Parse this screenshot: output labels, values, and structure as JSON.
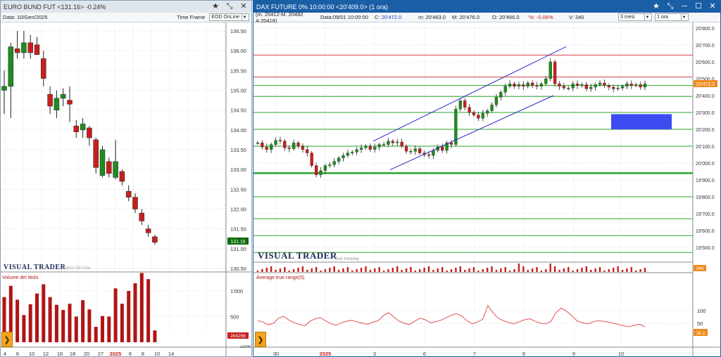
{
  "left": {
    "title": "EURO BUND FUT  <131.16>  -0.24%",
    "date_label": "Data: 10/Gen/2025",
    "timeframe_label": "Time Frame",
    "timeframe_value": "EOD OnLine",
    "brand": "VISUAL TRADER",
    "brand_sub": "Storico On Line",
    "volume_label": "Volume del titolo",
    "volume_value_badge": "284256",
    "volume_unit": "x1000",
    "last_price_badge": "131.16",
    "price_ticks": [
      "136.50",
      "136.00",
      "135.50",
      "135.00",
      "134.50",
      "134.00",
      "133.50",
      "133.00",
      "132.50",
      "132.00",
      "131.50",
      "131.00",
      "130.50"
    ],
    "volume_ticks": [
      "1'000",
      "500"
    ],
    "x_ticks": [
      "4",
      "6",
      "10",
      "12",
      "16",
      "18",
      "20",
      "27",
      "2025",
      "6",
      "8",
      "10",
      "14"
    ],
    "colors": {
      "up": "#1e8c1e",
      "down": "#c81e1e",
      "volume": "#b01515",
      "badge": "#0a6a0a"
    }
  },
  "right": {
    "title": "DAX FUTURE 0%  10:00:00  <20'409.0>  (1 ora)",
    "ohlc": {
      "mid": "(m. 20412-M. 20482 A:20418)",
      "date": "Data:09/01 10:00:00",
      "c_label": "C:",
      "c_value": "20'472.0",
      "m_label": "m:",
      "m_value": "20'463.0",
      "M_label": "M:",
      "M_value": "20'476.0",
      "O_label": "O:",
      "O_value": "20'466.0",
      "pct_label": "%:",
      "pct_value": "-0.06%",
      "V_label": "V:",
      "V_value": "340"
    },
    "period_value": "3 mesi",
    "interval_value": "1 ora",
    "brand": "VISUAL TRADER",
    "brand_sub": "Dati Intraday",
    "atr_label": "Average true range(5)",
    "last_price_badge": "20'472.0",
    "volume_badge": "340",
    "atr_badge": "36.2",
    "price_ticks": [
      "20'800.0",
      "20'700.0",
      "20'600.0",
      "20'500.0",
      "20'400.0",
      "20'300.0",
      "20'200.0",
      "20'100.0",
      "20'000.0",
      "19'900.0",
      "19'800.0",
      "19'700.0",
      "19'600.0",
      "19'500.0"
    ],
    "atr_ticks": [
      "100",
      "50"
    ],
    "x_ticks": [
      "30",
      "2025",
      "3",
      "6",
      "7",
      "8",
      "9",
      "10"
    ],
    "colors": {
      "up": "#1e8c1e",
      "down": "#c81e1e",
      "channel": "#2828c8",
      "zone": "#3b4cf0",
      "atr": "#e05050",
      "hline_red": "#d24040",
      "hline_green": "#2aa52a"
    }
  },
  "chart_data": [
    {
      "type": "candlestick",
      "title": "EURO BUND FUT",
      "ylim": [
        130.5,
        136.7
      ],
      "candles": [
        {
          "x": "4",
          "o": 135.0,
          "h": 135.5,
          "l": 134.4,
          "c": 135.1
        },
        {
          "x": "5",
          "o": 135.1,
          "h": 136.2,
          "l": 134.3,
          "c": 136.1
        },
        {
          "x": "6",
          "o": 136.05,
          "h": 136.5,
          "l": 135.8,
          "c": 135.95
        },
        {
          "x": "9",
          "o": 135.95,
          "h": 136.5,
          "l": 135.8,
          "c": 136.2
        },
        {
          "x": "10",
          "o": 136.2,
          "h": 136.4,
          "l": 135.8,
          "c": 135.95
        },
        {
          "x": "11",
          "o": 136.15,
          "h": 136.35,
          "l": 135.9,
          "c": 135.9
        },
        {
          "x": "12",
          "o": 135.8,
          "h": 136.0,
          "l": 135.1,
          "c": 135.3
        },
        {
          "x": "13",
          "o": 134.9,
          "h": 135.1,
          "l": 134.4,
          "c": 134.6
        },
        {
          "x": "16",
          "o": 134.5,
          "h": 135.0,
          "l": 134.3,
          "c": 134.8
        },
        {
          "x": "17",
          "o": 134.8,
          "h": 135.05,
          "l": 134.6,
          "c": 134.9
        },
        {
          "x": "18",
          "o": 134.75,
          "h": 135.1,
          "l": 134.2,
          "c": 134.65
        },
        {
          "x": "19",
          "o": 134.1,
          "h": 134.25,
          "l": 133.8,
          "c": 133.95
        },
        {
          "x": "20",
          "o": 134.0,
          "h": 134.3,
          "l": 133.8,
          "c": 134.15
        },
        {
          "x": "23",
          "o": 134.05,
          "h": 134.1,
          "l": 133.6,
          "c": 133.8
        },
        {
          "x": "27",
          "o": 133.75,
          "h": 133.8,
          "l": 132.9,
          "c": 133.05
        },
        {
          "x": "30",
          "o": 132.85,
          "h": 133.6,
          "l": 132.8,
          "c": 133.5
        },
        {
          "x": "31",
          "o": 133.2,
          "h": 133.3,
          "l": 132.8,
          "c": 132.9
        },
        {
          "x": "2",
          "o": 132.8,
          "h": 133.75,
          "l": 132.75,
          "c": 133.2
        },
        {
          "x": "3",
          "o": 132.95,
          "h": 133.0,
          "l": 132.6,
          "c": 132.7
        },
        {
          "x": "6",
          "o": 132.45,
          "h": 132.6,
          "l": 132.2,
          "c": 132.3
        },
        {
          "x": "7",
          "o": 132.3,
          "h": 132.4,
          "l": 131.9,
          "c": 132.0
        },
        {
          "x": "8",
          "o": 131.9,
          "h": 132.0,
          "l": 131.6,
          "c": 131.7
        },
        {
          "x": "9",
          "o": 131.5,
          "h": 131.6,
          "l": 131.3,
          "c": 131.4
        },
        {
          "x": "10",
          "o": 131.3,
          "h": 131.35,
          "l": 131.1,
          "c": 131.16
        }
      ],
      "volume": [
        880,
        1100,
        830,
        530,
        740,
        950,
        1130,
        880,
        730,
        630,
        750,
        500,
        820,
        640,
        300,
        510,
        500,
        1050,
        750,
        1000,
        1150,
        1350,
        1230,
        230
      ]
    },
    {
      "type": "candlestick",
      "title": "DAX FUTURE",
      "ylim": [
        19450,
        20850
      ],
      "horizontal_lines_red": [
        20640,
        20510
      ],
      "horizontal_lines_green": [
        20460,
        20395,
        20300,
        20200,
        20100,
        19940,
        19800,
        19670,
        19570,
        19470
      ],
      "channel": [
        [
          20130,
          20690
        ],
        [
          19960,
          20400
        ]
      ],
      "zone": {
        "top": 20290,
        "bottom": 20200
      },
      "close_series": [
        20120,
        20095,
        20080,
        20110,
        20135,
        20130,
        20090,
        20085,
        20120,
        20100,
        20080,
        20060,
        19985,
        19930,
        19955,
        19985,
        19990,
        20010,
        20030,
        20045,
        20060,
        20065,
        20080,
        20090,
        20100,
        20080,
        20095,
        20110,
        20110,
        20130,
        20120,
        20125,
        20100,
        20070,
        20070,
        20085,
        20060,
        20050,
        20045,
        20075,
        20095,
        20075,
        20120,
        20110,
        20320,
        20370,
        20330,
        20300,
        20285,
        20265,
        20295,
        20310,
        20345,
        20390,
        20420,
        20455,
        20470,
        20455,
        20465,
        20455,
        20475,
        20460,
        20455,
        20470,
        20500,
        20600,
        20470,
        20455,
        20445,
        20445,
        20470,
        20460,
        20465,
        20440,
        20450,
        20465,
        20475,
        20460,
        20450,
        20440,
        20445,
        20455,
        20470,
        20460,
        20465,
        20450,
        20470
      ],
      "atr": [
        60,
        55,
        44,
        50,
        70,
        78,
        62,
        52,
        45,
        40,
        58,
        68,
        72,
        60,
        48,
        42,
        52,
        58,
        62,
        55,
        50,
        46,
        54,
        60,
        80,
        92,
        75,
        58,
        50,
        45,
        58,
        70,
        64,
        52,
        56,
        62,
        72,
        82,
        88,
        78,
        60,
        48,
        55,
        66,
        120,
        90,
        70,
        60,
        52,
        48,
        56,
        64,
        68,
        58,
        50,
        48,
        56,
        92,
        110,
        98,
        80,
        60,
        52,
        48,
        55,
        60,
        58,
        55,
        50,
        45,
        40,
        36,
        42,
        46,
        36.2
      ]
    }
  ]
}
